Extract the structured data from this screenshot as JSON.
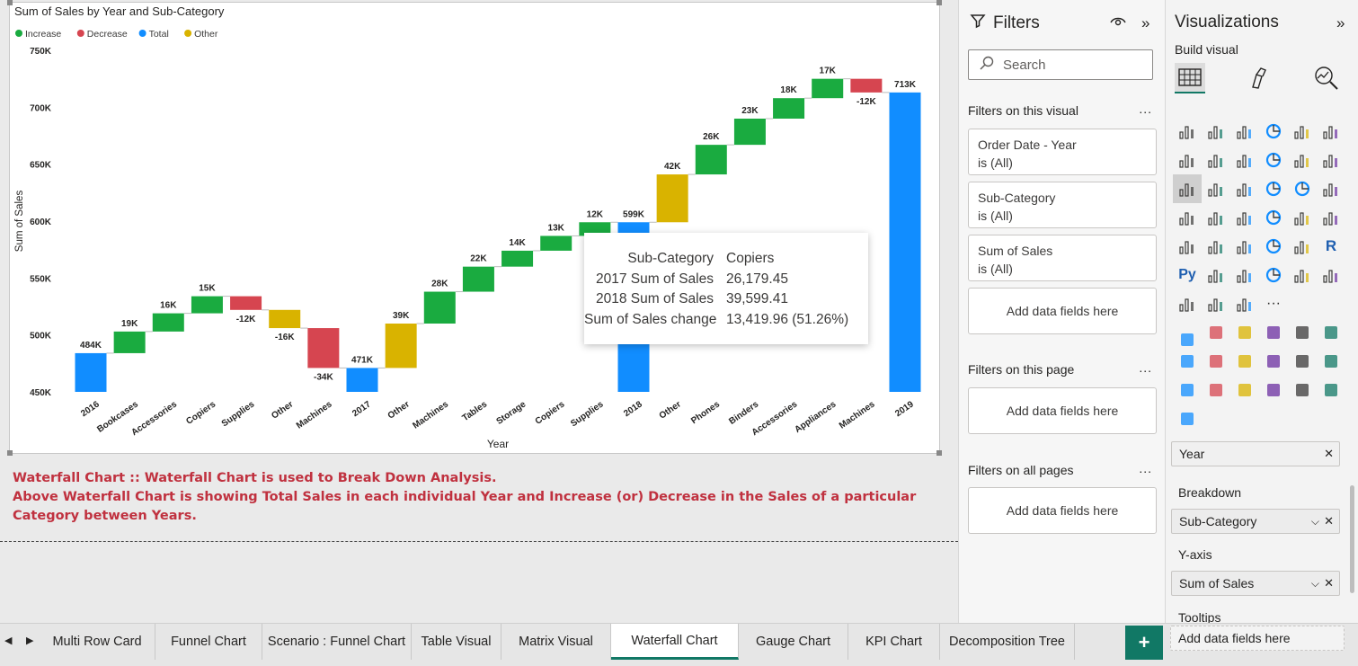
{
  "visual": {
    "caption_line1": "Waterfall Chart :: Waterfall Chart is used to Break Down Analysis.",
    "caption_line2": "Above Waterfall Chart is showing Total Sales in each individual Year and Increase (or) Decrease in the Sales of a particular Category between Years."
  },
  "chart_data": {
    "type": "waterfall",
    "title": "Sum of Sales by Year and Sub-Category",
    "xlabel": "Year",
    "ylabel": "Sum of Sales",
    "ylim": [
      450000,
      750000
    ],
    "yticks": [
      "450K",
      "500K",
      "550K",
      "600K",
      "650K",
      "700K",
      "750K"
    ],
    "legend": [
      {
        "name": "Increase",
        "color": "#1aab40"
      },
      {
        "name": "Decrease",
        "color": "#d64550"
      },
      {
        "name": "Total",
        "color": "#118dff"
      },
      {
        "name": "Other",
        "color": "#d9b300"
      }
    ],
    "legend_position": "top-left",
    "bars": [
      {
        "category": "2016",
        "kind": "Total",
        "start": 450000,
        "end": 484000,
        "label": "484K"
      },
      {
        "category": "Bookcases",
        "kind": "Increase",
        "start": 484000,
        "end": 503000,
        "label": "19K"
      },
      {
        "category": "Accessories",
        "kind": "Increase",
        "start": 503000,
        "end": 519000,
        "label": "16K"
      },
      {
        "category": "Copiers",
        "kind": "Increase",
        "start": 519000,
        "end": 534000,
        "label": "15K"
      },
      {
        "category": "Supplies",
        "kind": "Decrease",
        "start": 534000,
        "end": 522000,
        "label": "-12K"
      },
      {
        "category": "Other",
        "kind": "Other",
        "start": 522000,
        "end": 506000,
        "label": "-16K"
      },
      {
        "category": "Machines",
        "kind": "Decrease",
        "start": 506000,
        "end": 471000,
        "label": "-34K"
      },
      {
        "category": "2017",
        "kind": "Total",
        "start": 450000,
        "end": 471000,
        "label": "471K"
      },
      {
        "category": "Other",
        "kind": "Other",
        "start": 471000,
        "end": 510000,
        "label": "39K"
      },
      {
        "category": "Machines",
        "kind": "Increase",
        "start": 510000,
        "end": 538000,
        "label": "28K"
      },
      {
        "category": "Tables",
        "kind": "Increase",
        "start": 538000,
        "end": 560000,
        "label": "22K"
      },
      {
        "category": "Storage",
        "kind": "Increase",
        "start": 560000,
        "end": 574000,
        "label": "14K"
      },
      {
        "category": "Copiers",
        "kind": "Increase",
        "start": 574000,
        "end": 587000,
        "label": "13K"
      },
      {
        "category": "Supplies",
        "kind": "Increase",
        "start": 587000,
        "end": 599000,
        "label": "12K"
      },
      {
        "category": "2018",
        "kind": "Total",
        "start": 450000,
        "end": 599000,
        "label": "599K"
      },
      {
        "category": "Other",
        "kind": "Other",
        "start": 599000,
        "end": 641000,
        "label": "42K"
      },
      {
        "category": "Phones",
        "kind": "Increase",
        "start": 641000,
        "end": 667000,
        "label": "26K"
      },
      {
        "category": "Binders",
        "kind": "Increase",
        "start": 667000,
        "end": 690000,
        "label": "23K"
      },
      {
        "category": "Accessories",
        "kind": "Increase",
        "start": 690000,
        "end": 708000,
        "label": "18K"
      },
      {
        "category": "Appliances",
        "kind": "Increase",
        "start": 708000,
        "end": 725000,
        "label": "17K"
      },
      {
        "category": "Machines",
        "kind": "Decrease",
        "start": 725000,
        "end": 713000,
        "label": "-12K"
      },
      {
        "category": "2019",
        "kind": "Total",
        "start": 450000,
        "end": 713000,
        "label": "713K"
      }
    ],
    "grid": false
  },
  "tooltip": {
    "rows": [
      {
        "k": "Sub-Category",
        "v": "Copiers"
      },
      {
        "k": "2017 Sum of Sales",
        "v": "26,179.45"
      },
      {
        "k": "2018 Sum of Sales",
        "v": "39,599.41"
      },
      {
        "k": "Sum of Sales change",
        "v": "13,419.96 (51.26%)"
      }
    ]
  },
  "filters": {
    "title": "Filters",
    "search_placeholder": "Search",
    "on_visual": "Filters on this visual",
    "cards": [
      {
        "name": "Order Date - Year",
        "state": "is (All)"
      },
      {
        "name": "Sub-Category",
        "state": "is (All)"
      },
      {
        "name": "Sum of Sales",
        "state": "is (All)"
      }
    ],
    "add_here": "Add data fields here",
    "on_page": "Filters on this page",
    "on_all": "Filters on all pages",
    "more": "..."
  },
  "viz": {
    "title": "Visualizations",
    "build": "Build visual",
    "wells": {
      "year_chip": "Year",
      "breakdown_label": "Breakdown",
      "breakdown_chip": "Sub-Category",
      "yaxis_label": "Y-axis",
      "yaxis_chip": "Sum of Sales",
      "tooltips_label": "Tooltips",
      "tooltips_add": "Add data fields here"
    }
  },
  "tabs": [
    "Multi Row Card",
    "Funnel Chart",
    "Scenario : Funnel Chart",
    "Table Visual",
    "Matrix Visual",
    "Waterfall Chart",
    "Gauge Chart",
    "KPI Chart",
    "Decomposition Tree"
  ],
  "active_tab": "Waterfall Chart"
}
